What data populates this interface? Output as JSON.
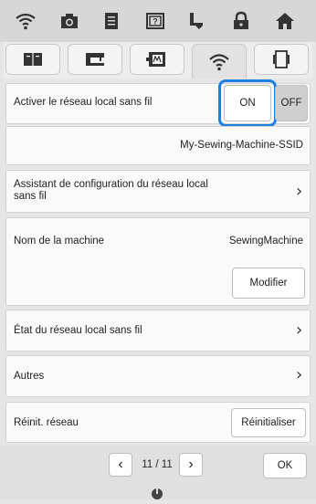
{
  "top_tabs": [
    {
      "icon": "wifi-icon"
    },
    {
      "icon": "camera-icon"
    },
    {
      "icon": "document-icon"
    },
    {
      "icon": "help-icon"
    },
    {
      "icon": "embroidery-icon"
    },
    {
      "icon": "lock-icon"
    },
    {
      "icon": "home-icon"
    }
  ],
  "sub_tabs": [
    {
      "icon": "book-icon"
    },
    {
      "icon": "sewing-machine-icon"
    },
    {
      "icon": "embroidery-frame-icon"
    },
    {
      "icon": "wifi-icon",
      "active": true
    },
    {
      "icon": "pages-icon"
    }
  ],
  "wlan": {
    "label": "Activer le réseau local sans fil",
    "on_label": "ON",
    "off_label": "OFF",
    "state": "ON",
    "ssid": "My-Sewing-Machine-SSID"
  },
  "assistant": {
    "label": "Assistant de configuration du réseau local sans fil"
  },
  "machine": {
    "label": "Nom de la machine",
    "value": "SewingMachine",
    "button": "Modifier"
  },
  "status": {
    "label": "État du réseau local sans fil"
  },
  "others": {
    "label": "Autres"
  },
  "reset": {
    "label": "Réinit. réseau",
    "button": "Réinitialiser"
  },
  "pagination": {
    "page": "11 / 11",
    "ok": "OK"
  },
  "colors": {
    "highlight": "#1e7fe0"
  }
}
